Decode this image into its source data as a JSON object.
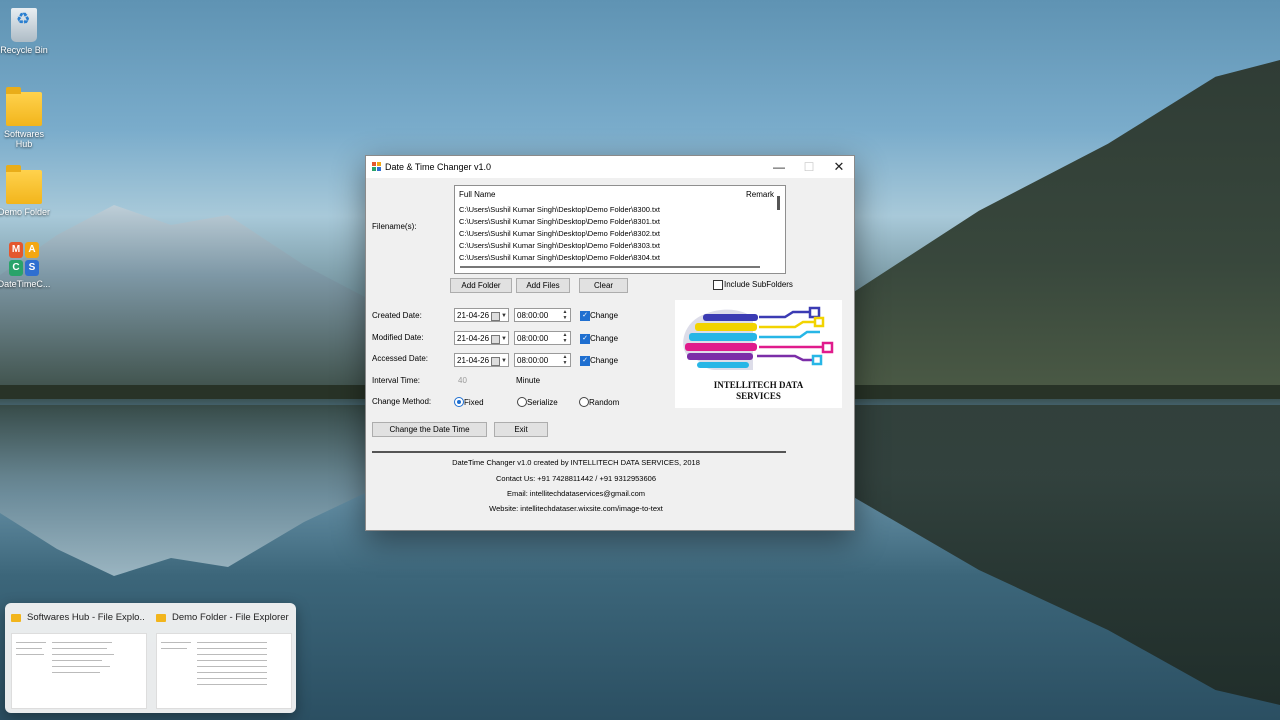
{
  "desktop": {
    "icons": [
      {
        "label": "Recycle Bin"
      },
      {
        "label": "Softwares Hub"
      },
      {
        "label": "Demo Folder"
      },
      {
        "label": "DateTimeC..."
      }
    ]
  },
  "window": {
    "title": "Date & Time Changer v1.0",
    "controls": {
      "minimize": "—",
      "maximize": "☐",
      "close": "✕"
    },
    "filenames_label": "Filename(s):",
    "list": {
      "col_fullname": "Full Name",
      "col_remark": "Remark",
      "rows": [
        "C:\\Users\\Sushil Kumar Singh\\Desktop\\Demo Folder\\8300.txt",
        "C:\\Users\\Sushil Kumar Singh\\Desktop\\Demo Folder\\8301.txt",
        "C:\\Users\\Sushil Kumar Singh\\Desktop\\Demo Folder\\8302.txt",
        "C:\\Users\\Sushil Kumar Singh\\Desktop\\Demo Folder\\8303.txt",
        "C:\\Users\\Sushil Kumar Singh\\Desktop\\Demo Folder\\8304.txt"
      ]
    },
    "buttons": {
      "add_folder": "Add Folder",
      "add_files": "Add Files",
      "clear": "Clear",
      "change": "Change the Date  Time",
      "exit": "Exit"
    },
    "include_subfolders": {
      "label": "Include SubFolders",
      "checked": false
    },
    "created": {
      "label": "Created Date:",
      "date": "21-04-26",
      "time": "08:00:00",
      "change_label": "Change",
      "checked": true
    },
    "modified": {
      "label": "Modified Date:",
      "date": "21-04-26",
      "time": "08:00:00",
      "change_label": "Change",
      "checked": true
    },
    "accessed": {
      "label": "Accessed Date:",
      "date": "21-04-26",
      "time": "08:00:00",
      "change_label": "Change",
      "checked": true
    },
    "interval": {
      "label": "Interval Time:",
      "value": "40",
      "unit": "Minute"
    },
    "method": {
      "label": "Change Method:",
      "options": [
        "Fixed",
        "Serialize",
        "Random"
      ],
      "selected": "Fixed"
    },
    "logo_text_line1": "INTELLITECH DATA",
    "logo_text_line2": "SERVICES",
    "footer": {
      "created_by": "DateTime Changer v1.0 created by INTELLITECH DATA SERVICES, 2018",
      "contact": "Contact Us: +91 7428811442 / +91 9312953606",
      "email": "Email: intellitechdataservices@gmail.com",
      "website": "Website: intellitechdataser.wixsite.com/image-to-text"
    }
  },
  "taskbar_previews": [
    {
      "title": "Softwares Hub - File Explo..."
    },
    {
      "title": "Demo Folder - File Explorer"
    }
  ],
  "colors": {
    "accent": "#1f6fd0",
    "folder": "#f2b51c"
  }
}
